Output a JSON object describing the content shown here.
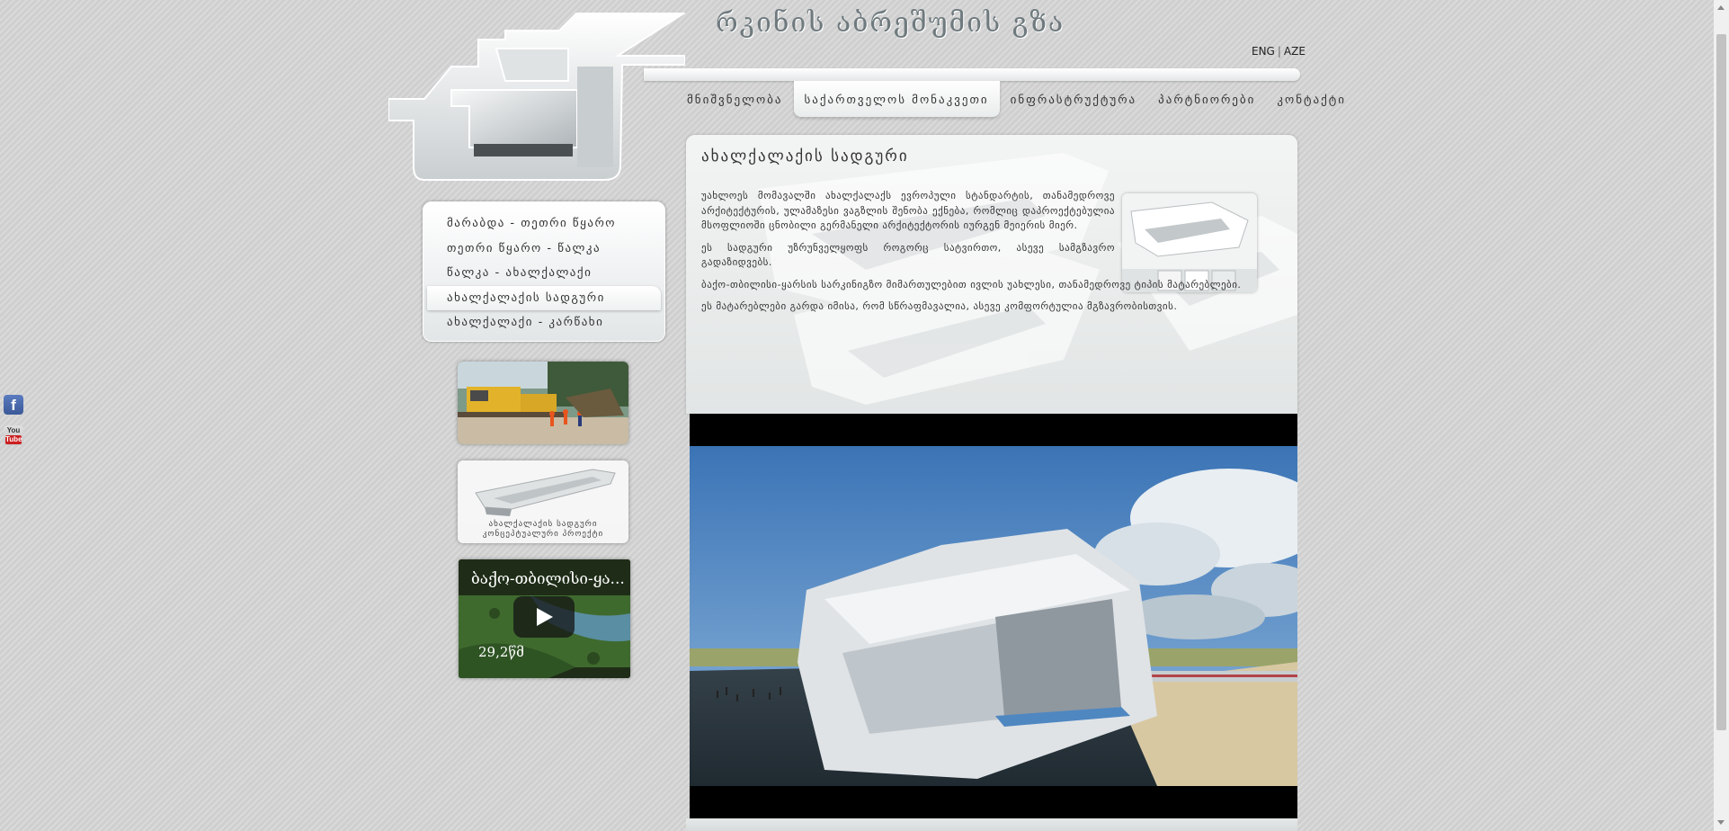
{
  "header": {
    "site_title": "რკინის აბრეშუმის გზა",
    "lang": {
      "eng": "ENG",
      "separator": "|",
      "aze": "AZE"
    }
  },
  "nav": {
    "items": [
      {
        "label": "მნიშვნელობა",
        "active": false
      },
      {
        "label": "საქართველოს მონაკვეთი",
        "active": true
      },
      {
        "label": "ინფრასტრუქტურა",
        "active": false
      },
      {
        "label": "პარტნიორები",
        "active": false
      },
      {
        "label": "კონტაქტი",
        "active": false
      }
    ]
  },
  "sidebar": {
    "menu": [
      {
        "label": "მარაბდა - თეთრი წყარო",
        "active": false
      },
      {
        "label": "თეთრი წყარო - წალკა",
        "active": false
      },
      {
        "label": "წალკა - ახალქალაქი",
        "active": false
      },
      {
        "label": "ახალქალაქის სადგური",
        "active": true
      },
      {
        "label": "ახალქალაქი - კარწახი",
        "active": false
      }
    ],
    "promo_station_caption_1": "ახალქალაქის სადგური",
    "promo_station_caption_2": "კონცეპტუალური პროექტი",
    "video": {
      "title": "ბაქო-თბილისი-ყა...",
      "duration": "29,2წმ"
    }
  },
  "social": {
    "facebook_glyph": "f",
    "youtube_you": "You",
    "youtube_tube": "Tube"
  },
  "content": {
    "title": "ახალქალაქის სადგური",
    "paragraphs": [
      "უახლოეს მომავალში ახალქალაქს ევროპული სტანდარტის, თანამედროვე არქიტექტურის, ულამაზესი ვაგზლის შენობა ექნება, რომლიც დაპროექტებულია მსოფლიოში ცნობილი გერმანელი არქიტექტორის იურგენ მეიერის მიერ.",
      "ეს სადგური უზრუნველყოფს როგორც სატვირთო, ასევე სამგზავრო გადაზიდვებს.",
      "ბაქო-თბილისი-ყარსის სარკინიგზო მიმართულებით ივლის უახლესი, თანამედროვე ტიპის მატარებლები.",
      "ეს მატარებლები გარდა იმისა, რომ სწრაფმავალია, ასევე კომფორტულია მგზავრობისთვის."
    ]
  }
}
